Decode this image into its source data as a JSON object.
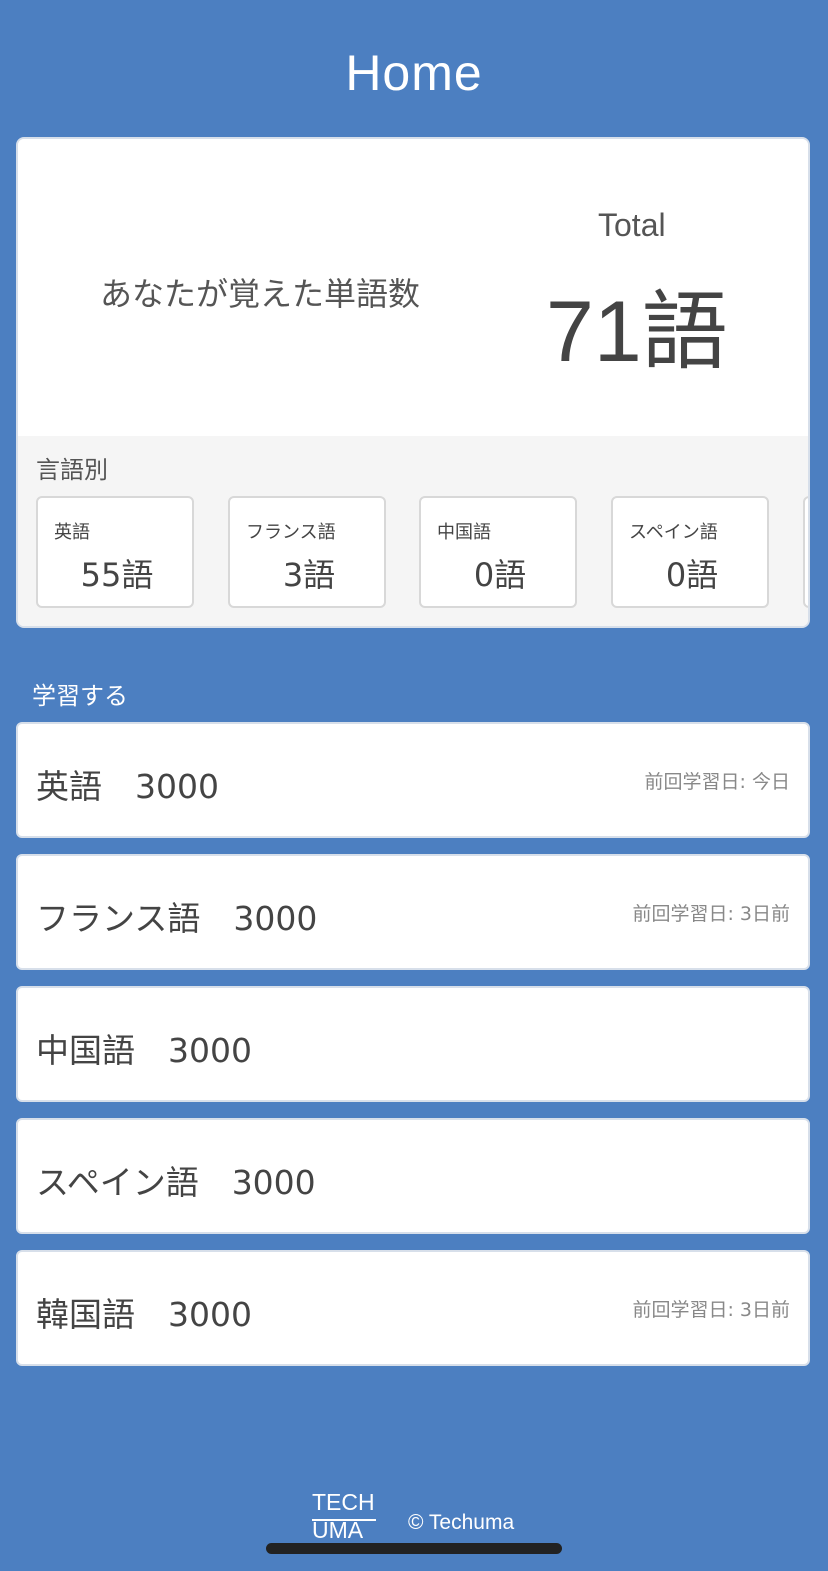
{
  "header": {
    "title": "Home"
  },
  "summary": {
    "learned_label": "あなたが覚えた単語数",
    "total_label": "Total",
    "total_value": "71語"
  },
  "by_language": {
    "label": "言語別",
    "items": [
      {
        "name": "英語",
        "count": "55語"
      },
      {
        "name": "フランス語",
        "count": "3語"
      },
      {
        "name": "中国語",
        "count": "0語"
      },
      {
        "name": "スペイン語",
        "count": "0語"
      }
    ]
  },
  "study": {
    "label": "学習する",
    "courses": [
      {
        "name": "英語　3000",
        "last_studied": "前回学習日: 今日"
      },
      {
        "name": "フランス語　3000",
        "last_studied": "前回学習日: 3日前"
      },
      {
        "name": "中国語　3000",
        "last_studied": ""
      },
      {
        "name": "スペイン語　3000",
        "last_studied": ""
      },
      {
        "name": "韓国語　3000",
        "last_studied": "前回学習日: 3日前"
      }
    ]
  },
  "footer": {
    "logo_line1": "TECH",
    "logo_line2": "UMA",
    "copyright": "© Techuma"
  },
  "colors": {
    "background": "#4c7fc1",
    "card": "#ffffff",
    "panel": "#f5f5f5",
    "text": "#444444",
    "muted": "#888888"
  }
}
